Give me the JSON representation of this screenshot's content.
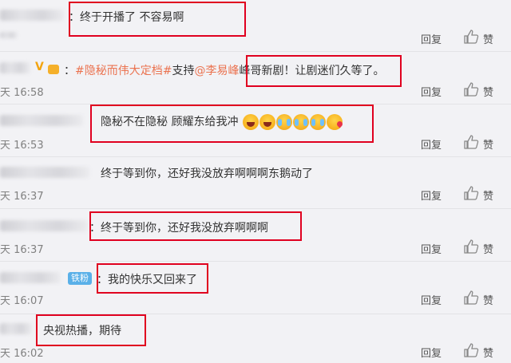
{
  "comments": [
    {
      "text": "：终于开播了 不容易啊",
      "time": "",
      "reply": "回复",
      "like": "赞"
    },
    {
      "tag": "#隐秘而伟大定档#",
      "support": "支持",
      "mention": "@李易峰",
      "text": "峰哥新剧！让剧迷们久等了。",
      "time": "天 16:58",
      "reply": "回复",
      "like": "赞"
    },
    {
      "text": "隐秘不在隐秘 顾耀东给我冲",
      "time": "天 16:53",
      "reply": "回复",
      "like": "赞"
    },
    {
      "text": "终于等到你，还好我没放弃啊啊啊东鹅动了",
      "time": "天 16:37",
      "reply": "回复",
      "like": "赞"
    },
    {
      "text": "：终于等到你，还好我没放弃啊啊啊",
      "time": "天 16:37",
      "reply": "回复",
      "like": "赞"
    },
    {
      "badge": "铁粉",
      "text": "：我的快乐又回来了",
      "time": "天 16:07",
      "reply": "回复",
      "like": "赞"
    },
    {
      "text": "央视热播，期待",
      "time": "天 16:02",
      "reply": "回复",
      "like": "赞"
    }
  ],
  "icons": {
    "like": "thumbs-up-icon",
    "vip": "v-badge-icon",
    "crown": "crown-icon"
  },
  "colors": {
    "highlight": "#e0001f",
    "link": "#eb7350",
    "fan_badge": "#5ab0e8"
  }
}
